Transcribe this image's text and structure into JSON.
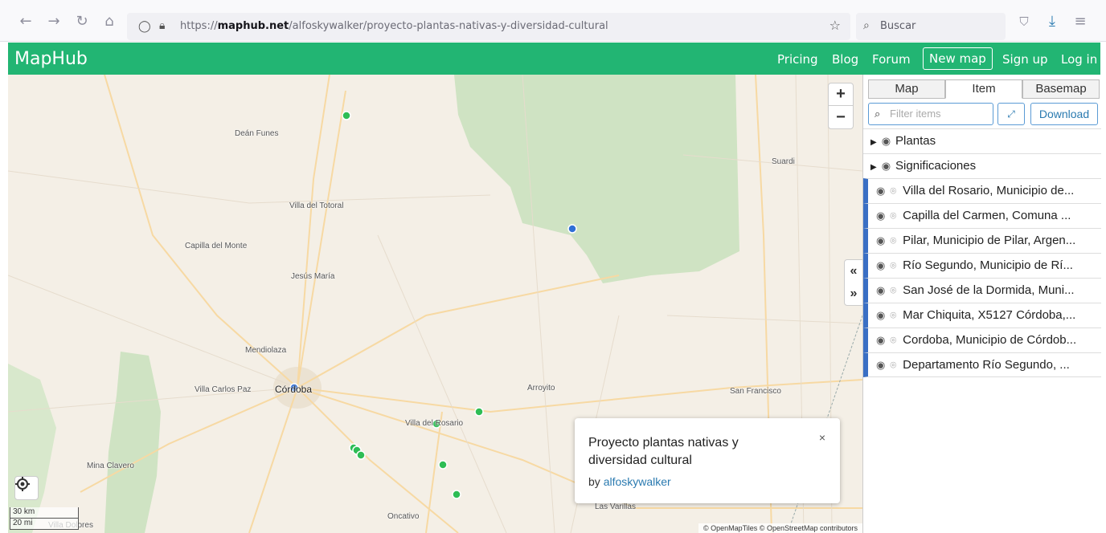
{
  "browser": {
    "url_prefix": "https://",
    "url_domain": "maphub.net",
    "url_path": "/alfoskywalker/proyecto-plantas-nativas-y-diversidad-cultural",
    "search_placeholder": "Buscar"
  },
  "header": {
    "brand": "MapHub",
    "links": {
      "pricing": "Pricing",
      "blog": "Blog",
      "forum": "Forum",
      "new_map": "New map",
      "sign_up": "Sign up",
      "log_in": "Log in"
    }
  },
  "map": {
    "places": {
      "dean_funes": "Deán Funes",
      "suardi": "Suardi",
      "villa_del_totoral": "Villa del Totoral",
      "capilla_del_monte": "Capilla del Monte",
      "jesus_maria": "Jesús María",
      "mendiolaza": "Mendiolaza",
      "villa_carlos_paz": "Villa Carlos Paz",
      "cordoba": "Córdoba",
      "arroyito": "Arroyito",
      "san_francisco": "San Francisco",
      "villa_del_rosario": "Villa del Rosario",
      "mina_clavero": "Mina Clavero",
      "oncativo": "Oncativo",
      "las_varillas": "Las Varillas",
      "villa_dolores": "Villa Dolores"
    },
    "zoom_in": "+",
    "zoom_out": "−",
    "scale_km": "30 km",
    "scale_mi": "20 mi",
    "attribution": "© OpenMapTiles © OpenStreetMap contributors",
    "marker_colors": {
      "green": "#2ebd55",
      "blue": "#2f6fd6"
    }
  },
  "popup": {
    "title": "Proyecto plantas nativas y diversidad cultural",
    "by_label": "by",
    "author": "alfoskywalker",
    "close": "×"
  },
  "panel": {
    "tabs": [
      "Map",
      "Item",
      "Basemap"
    ],
    "active_tab": "Item",
    "filter_placeholder": "Filter items",
    "download_label": "Download",
    "groups": [
      "Plantas",
      "Significaciones"
    ],
    "items": [
      "Villa del Rosario, Municipio de...",
      "Capilla del Carmen, Comuna ...",
      "Pilar, Municipio de Pilar, Argen...",
      "Río Segundo, Municipio de Rí...",
      "San José de la Dormida, Muni...",
      "Mar Chiquita, X5127 Córdoba,...",
      "Cordoba, Municipio de Córdob...",
      "Departamento Río Segundo, ..."
    ]
  }
}
